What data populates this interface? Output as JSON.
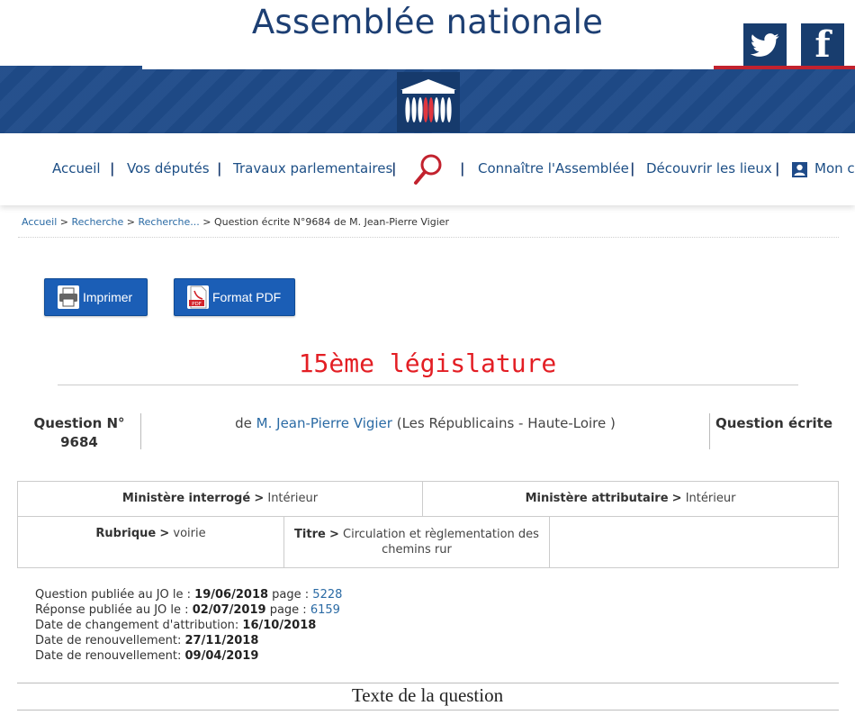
{
  "header": {
    "site_title": "Assemblée nationale",
    "social": [
      "twitter-icon",
      "facebook-icon"
    ],
    "facebook_glyph": "f"
  },
  "nav": {
    "items": [
      "Accueil",
      "Vos députés",
      "Travaux parlementaires",
      "Connaître l'Assemblée",
      "Découvrir les lieux",
      "Mon c"
    ],
    "separator": "|",
    "search_icon": "search-icon",
    "user_icon": "user-icon"
  },
  "breadcrumb": {
    "items": [
      "Accueil",
      "Recherche",
      "Recherche...",
      "Question écrite N°9684 de M. Jean-Pierre Vigier"
    ],
    "separator": ">"
  },
  "actions": {
    "print": "Imprimer",
    "pdf": "Format PDF"
  },
  "legislature": "15ème législature",
  "question": {
    "number_line1": "Question N°",
    "number_line2": "9684",
    "author_prefix": "de",
    "author": "M. Jean-Pierre Vigier",
    "author_suffix": "(Les Républicains - Haute-Loire )",
    "type": "Question écrite"
  },
  "table": {
    "ministere_interroge_label": "Ministère interrogé",
    "ministere_interroge_value": "Intérieur",
    "ministere_attributaire_label": "Ministère attributaire",
    "ministere_attributaire_value": "Intérieur",
    "rubrique_label": "Rubrique",
    "rubrique_value": "voirie",
    "titre_label": "Titre",
    "titre_value": "Circulation et règlementation des chemins rur",
    "arrow": ">"
  },
  "dates": {
    "question_label": "Question publiée au JO le :",
    "question_date": "19/06/2018",
    "page_label": "page :",
    "question_page": "5228",
    "reponse_label": "Réponse publiée au JO le :",
    "reponse_date": "02/07/2019",
    "reponse_page": "6159",
    "changement_label": "Date de changement d'attribution:",
    "changement_date": "16/10/2018",
    "renouvellement_label": "Date de renouvellement:",
    "renouvellement_1": "27/11/2018",
    "renouvellement_2": "09/04/2019"
  },
  "section_title": "Texte de la question",
  "colors": {
    "brand_blue": "#1f4b89",
    "title_blue": "#1d3f73",
    "link_blue": "#2a6aa4",
    "legislature_red": "#e31e24",
    "button_blue": "#1b5eb6"
  }
}
